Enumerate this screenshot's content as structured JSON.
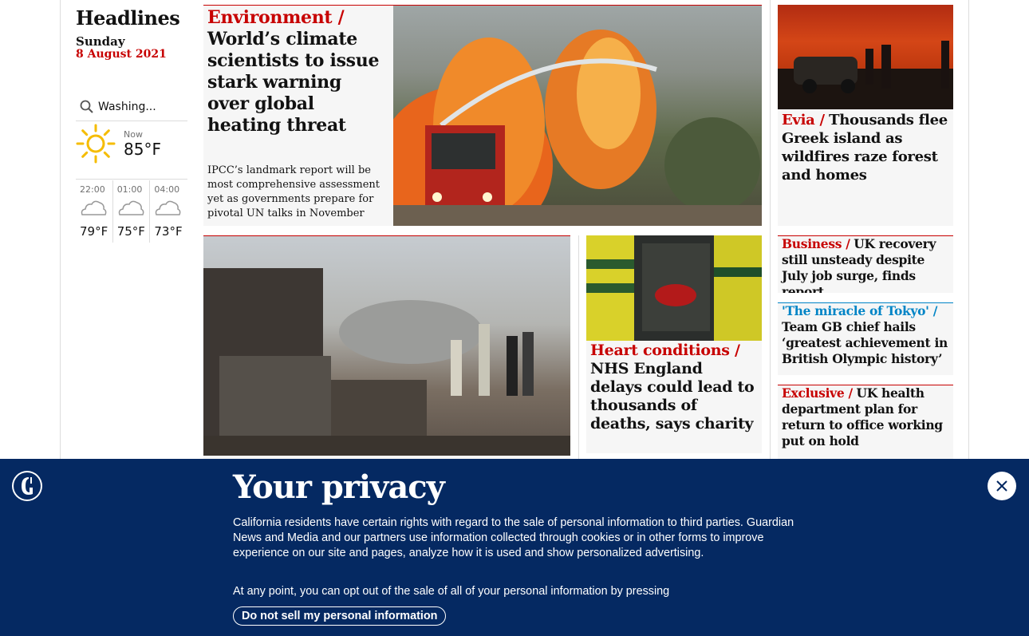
{
  "sidebar": {
    "title": "Headlines",
    "day": "Sunday",
    "date": "8 August 2021"
  },
  "weather": {
    "location_value": "Washing...",
    "now_label": "Now",
    "now_temp": "85°F",
    "forecast": [
      {
        "time": "22:00",
        "temp": "79°F",
        "icon": "cloud-icon"
      },
      {
        "time": "01:00",
        "temp": "75°F",
        "icon": "cloud-icon"
      },
      {
        "time": "04:00",
        "temp": "73°F",
        "icon": "cloud-icon"
      }
    ]
  },
  "main_story": {
    "kicker": "Environment /",
    "headline": "World’s climate scientists to issue stark warning over global heating threat",
    "standfirst": "IPCC’s landmark report will be most comprehensive assessment yet as governments prepare for pivotal UN talks in November"
  },
  "stories": [
    {
      "kicker": "Evia /",
      "headline": "Thousands flee Greek island as wildfires raze forest and homes"
    },
    {
      "kicker": "Business /",
      "headline": "UK recovery still unsteady despite July job surge, finds report"
    },
    {
      "kicker": "'The miracle of Tokyo' /",
      "headline": "Team GB chief hails ‘greatest achievement in British Olympic history’"
    },
    {
      "kicker": "Exclusive /",
      "headline": "UK health department plan for return to office working put on hold"
    },
    {
      "kicker": "Heart conditions /",
      "headline": "NHS England delays could lead to thousands of deaths, says charity"
    }
  ],
  "privacy": {
    "title": "Your privacy",
    "body": "California residents have certain rights with regard to the sale of personal information to third parties. Guardian News and Media and our partners use information collected through cookies or in other forms to improve experience on our site and pages, analyze how it is used and show personalized advertising.",
    "line2": "At any point, you can opt out of the sale of all of your personal information by pressing",
    "button": "Do not sell my personal information"
  },
  "colors": {
    "news_red": "#c70000",
    "sport_blue": "#0084c6",
    "banner_navy": "#052962"
  }
}
